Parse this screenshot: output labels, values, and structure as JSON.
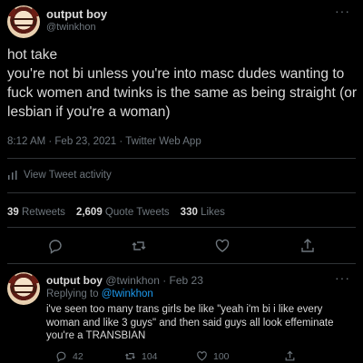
{
  "tweet": {
    "author_name": "output boy",
    "author_handle": "@twinkhon",
    "more": "···",
    "text": "hot take\nyou're not bi unless you're into masc dudes wanting to fuck women and twinks is the same as being straight (or lesbian if you're a woman)",
    "meta": "8:12 AM · Feb 23, 2021 · Twitter Web App",
    "activity_label": "View Tweet activity",
    "stats": {
      "retweets_count": "39",
      "retweets_label": "Retweets",
      "quotes_count": "2,609",
      "quotes_label": "Quote Tweets",
      "likes_count": "330",
      "likes_label": "Likes"
    }
  },
  "reply": {
    "author_name": "output boy",
    "author_handle": "@twinkhon",
    "date": "· Feb 23",
    "more": "···",
    "replying_prefix": "Replying to",
    "replying_handle": "@twinkhon",
    "text": "i've seen too many trans girls be like \"yeah i'm bi i like every woman and like 3 guys\" and then said guys all look effeminate you're a TRANSBIAN",
    "counts": {
      "replies": "42",
      "retweets": "104",
      "likes": "100"
    }
  },
  "icons": [
    "comment-icon",
    "retweet-icon",
    "like-icon",
    "share-icon",
    "analytics-icon",
    "more-icon"
  ],
  "colors": {
    "background": "#000000",
    "text": "#d9d9d9",
    "muted": "#6e767d",
    "link": "#1d9bf0",
    "divider": "#2f3336"
  }
}
